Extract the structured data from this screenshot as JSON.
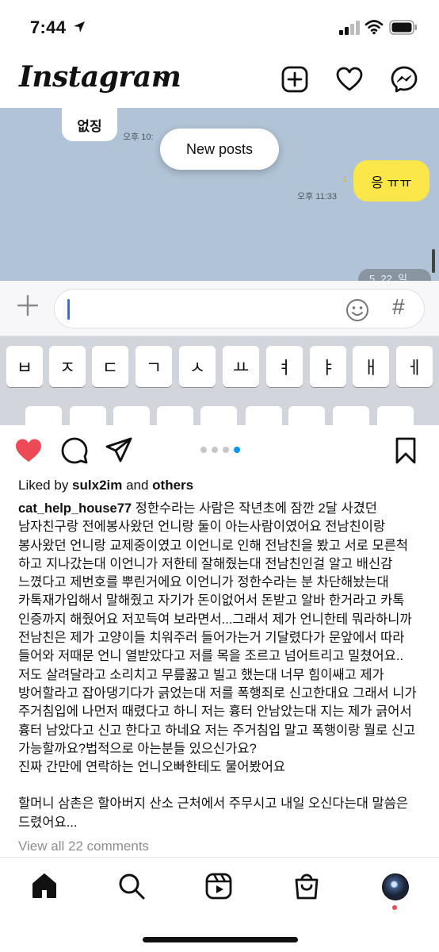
{
  "status_bar": {
    "time": "7:44"
  },
  "header": {
    "logo": "Instagram",
    "icons": [
      "plus-square-icon",
      "heart-icon",
      "messenger-icon"
    ]
  },
  "media": {
    "chat_left_bubble": "없징",
    "chat_left_time": "오후 10:",
    "new_posts_label": "New posts",
    "chat_read_count": "1",
    "chat_right_time": "오후 11:33",
    "chat_right_bubble": "응 ㅠㅠ",
    "date_chip": "5. 22. 일",
    "input_hash": "#",
    "keyboard_row1": [
      "ㅂ",
      "ㅈ",
      "ㄷ",
      "ㄱ",
      "ㅅ",
      "ㅛ",
      "ㅕ",
      "ㅑ",
      "ㅐ",
      "ㅔ"
    ],
    "carousel": {
      "count": 4,
      "active_index": 3
    }
  },
  "post": {
    "liked_prefix": "Liked by ",
    "liked_user": "sulx2im",
    "liked_and": " and ",
    "liked_others": "others",
    "username": "cat_help_house77",
    "caption_first": " 정한수라는 사람은 작년초에 잠깐 2달 사겼던 남자친구랑 전에봉사왔던 언니랑 둘이 아는사람이였어요 전남친이랑 봉사왔던 언니랑 교제중이였고 이언니로 인해 전남친을 봤고 서로 모른척 하고 지나갔는대 이언니가 저한테 잘해줬는대 전남친인걸 알고 배신감 느꼈다고 제번호를 뿌린거에요 이언니가 정한수라는 분 차단해놨는대 카톡재가입해서 말해줬고 자기가 돈이없어서 돈받고 알바 한거라고 카톡 인증까지 해줬어요 저꼬득여 보라면서...그래서 제가 언니한테 뭐라하니까 전남친은 제가 고양이들 치워주러 들어가는거 기달렸다가 문앞에서 따라 들어와 저때문 언니 열받았다고 저를 목을 조르고 넘어트리고 밀쳤어요..저도 살려달라고 소리치고 무릎꿇고 빌고 했는대 너무 힘이쌔고 제가 방어할라고 잡아댕기다가 긁었는대 저를 폭행죄로 신고한대요 그래서 니가 주거침입에 나먼저 때렸다고 하니 저는 흉터 안남았는대 지는 제가 긁어서 흉터 남았다고 신고 한다고 하네요 저는 주거침입 말고 폭행이랑 뭘로 신고 가능할까요?법적으로 아는분들 있으신가요?",
    "caption_line2": "진짜 간만에 연락하는 언니오빠한테도 물어봤어요",
    "caption_line3": "할머니 삼촌은 할아버지 산소 근처에서 주무시고 내일 오신다는대 말씀은 드렸어요...",
    "view_comments": "View all 22 comments"
  },
  "colors": {
    "like_red": "#ed4956",
    "chat_bg": "#b1c3d6",
    "kakao_yellow": "#fbe74a",
    "carousel_active": "#0095f6"
  }
}
